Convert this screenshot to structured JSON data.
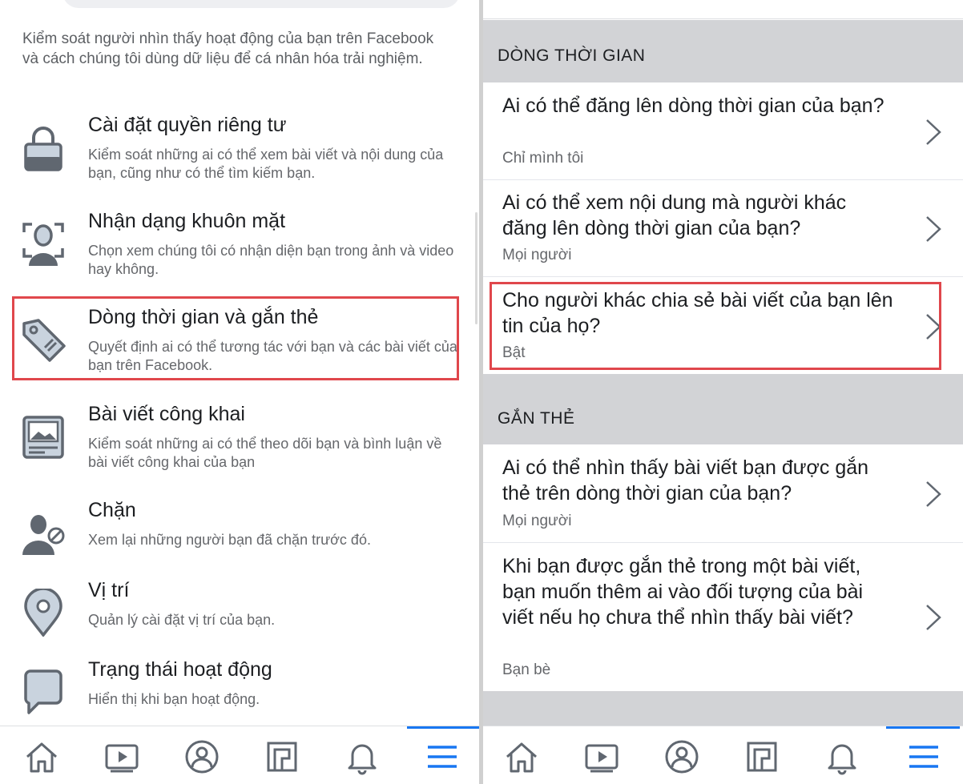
{
  "left": {
    "section_description": "Kiểm soát người nhìn thấy hoạt động của bạn trên Facebook và cách chúng tôi dùng dữ liệu để cá nhân hóa trải nghiệm.",
    "items": [
      {
        "title": "Cài đặt quyền riêng tư",
        "subtitle": "Kiểm soát những ai có thể xem bài viết và nội dung của bạn, cũng như có thể tìm kiếm bạn.",
        "icon": "lock-icon"
      },
      {
        "title": "Nhận dạng khuôn mặt",
        "subtitle": "Chọn xem chúng tôi có nhận diện bạn trong ảnh và video hay không.",
        "icon": "face-scan-icon"
      },
      {
        "title": "Dòng thời gian và gắn thẻ",
        "subtitle": "Quyết định ai có thể tương tác với bạn và các bài viết của bạn trên Facebook.",
        "icon": "tag-icon"
      },
      {
        "title": "Bài viết công khai",
        "subtitle": "Kiểm soát những ai có thể theo dõi bạn và bình luận về bài viết công khai của bạn",
        "icon": "public-post-icon"
      },
      {
        "title": "Chặn",
        "subtitle": "Xem lại những người bạn đã chặn trước đó.",
        "icon": "block-user-icon"
      },
      {
        "title": "Vị trí",
        "subtitle": "Quản lý cài đặt vị trí của bạn.",
        "icon": "location-pin-icon"
      },
      {
        "title": "Trạng thái hoạt động",
        "subtitle": "Hiển thị khi bạn hoạt động.",
        "icon": "chat-bubble-icon"
      }
    ]
  },
  "right": {
    "sections": [
      {
        "header": "DÒNG THỜI GIAN",
        "rows": [
          {
            "question": "Ai có thể đăng lên dòng thời gian của bạn?",
            "answer": "Chỉ mình tôi"
          },
          {
            "question": "Ai có thể xem nội dung mà người khác đăng lên dòng thời gian của bạn?",
            "answer": "Mọi người"
          },
          {
            "question": "Cho người khác chia sẻ bài viết của bạn lên tin của họ?",
            "answer": "Bật"
          }
        ]
      },
      {
        "header": "GẮN THẺ",
        "rows": [
          {
            "question": "Ai có thể nhìn thấy bài viết bạn được gắn thẻ trên dòng thời gian của bạn?",
            "answer": "Mọi người"
          },
          {
            "question": "Khi bạn được gắn thẻ trong một bài viết, bạn muốn thêm ai vào đối tượng của bài viết nếu họ chưa thể nhìn thấy bài viết?",
            "answer": "Bạn bè"
          }
        ]
      }
    ]
  },
  "nav": [
    "home-icon",
    "watch-icon",
    "profile-icon",
    "pages-icon",
    "notifications-icon",
    "menu-icon"
  ],
  "colors": {
    "accent": "#1877f2",
    "highlight": "#e0474c",
    "icon_gray": "#606770",
    "icon_light": "#c9d3de"
  }
}
